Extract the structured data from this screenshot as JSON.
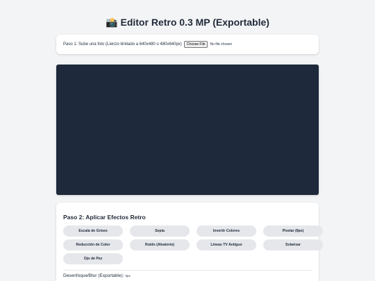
{
  "header": {
    "icon": "camera-with-flash-icon",
    "icon_glyph": "📸",
    "title": "Editor Retro 0.3 MP (Exportable)"
  },
  "upload": {
    "label": "Paso 1: Sube una foto (Lienzo limitado a 640x480 o 480x640px)",
    "button_label": "Choose File",
    "status": "No file chosen"
  },
  "canvas": {
    "background_color": "#1e293b"
  },
  "effects": {
    "heading": "Paso 2: Aplicar Efectos Retro",
    "buttons": [
      "Escala de Grises",
      "Sepia",
      "Invertir Colores",
      "Pixelar (8px)",
      "Reducción de Color",
      "Ruido (Aleatorio)",
      "Líneas TV Antiguo",
      "Solarizar",
      "Ojo de Pez"
    ],
    "blur_label": "Desenfoque/Blur (Exportable):",
    "blur_value": "0px"
  },
  "colors": {
    "page_bg": "#f3f4f6",
    "card_bg": "#ffffff",
    "button_bg": "#e5e7eb",
    "text": "#1f2937"
  }
}
